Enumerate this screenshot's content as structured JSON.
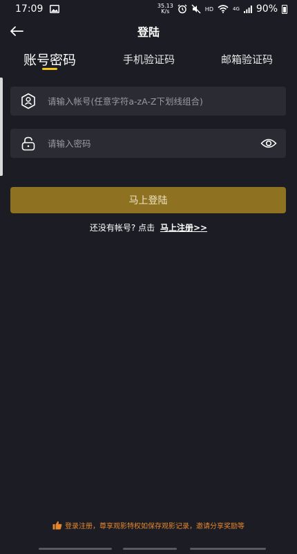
{
  "status_bar": {
    "time": "17:09",
    "net_speed_value": "35.13",
    "net_speed_unit": "K/s",
    "hd": "HD",
    "signal_tag": "4G",
    "battery": "90%"
  },
  "header": {
    "title": "登陆"
  },
  "tabs": [
    {
      "label": "账号密码",
      "active": true
    },
    {
      "label": "手机验证码",
      "active": false
    },
    {
      "label": "邮箱验证码",
      "active": false
    }
  ],
  "form": {
    "account_placeholder": "请输入帐号(任意字符a-zA-Z下划线组合)",
    "account_value": "",
    "password_placeholder": "请输入密码",
    "password_value": "",
    "submit_label": "马上登陆"
  },
  "register": {
    "prompt": "还没有帐号? 点击",
    "link_label": "马上注册>>"
  },
  "footer": {
    "note": "登录注册，尊享观影特权如保存观影记录，邀请分享奖励等"
  },
  "colors": {
    "background": "#1c1d24",
    "field_bg": "#2b2c33",
    "accent": "#f5c518",
    "button": "#8e7221",
    "footer_text": "#e5862b"
  }
}
